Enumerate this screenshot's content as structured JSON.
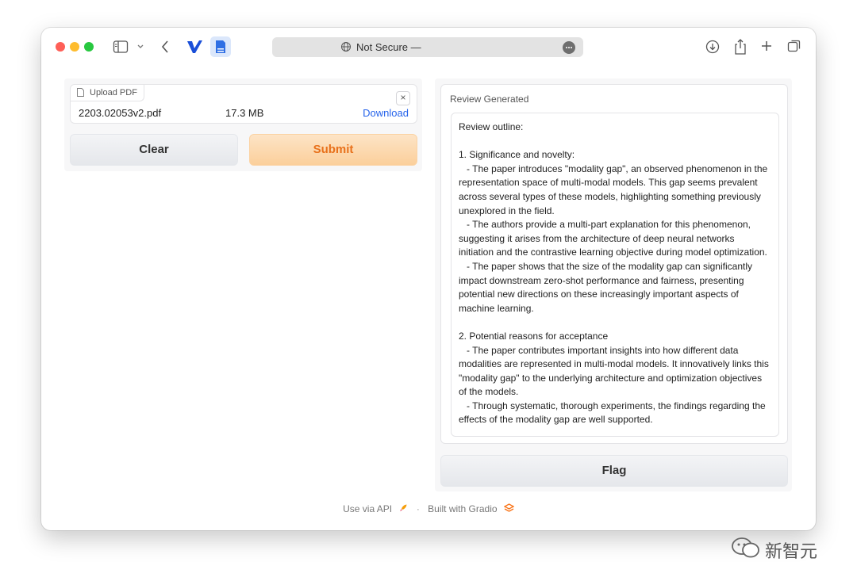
{
  "browser": {
    "address_text": "Not Secure —"
  },
  "upload": {
    "tab_label": "Upload PDF",
    "file_name": "2203.02053v2.pdf",
    "file_size": "17.3 MB",
    "download_label": "Download",
    "close_glyph": "×"
  },
  "buttons": {
    "clear_label": "Clear",
    "submit_label": "Submit",
    "flag_label": "Flag"
  },
  "review": {
    "label": "Review Generated",
    "text": "Review outline:\n\n1. Significance and novelty:\n   - The paper introduces \"modality gap\", an observed phenomenon in the representation space of multi-modal models. This gap seems prevalent across several types of these models, highlighting something previously unexplored in the field.\n   - The authors provide a multi-part explanation for this phenomenon, suggesting it arises from the architecture of deep neural networks initiation and the contrastive learning objective during model optimization.\n   - The paper shows that the size of the modality gap can significantly impact downstream zero-shot performance and fairness, presenting potential new directions on these increasingly important aspects of machine learning.\n\n2. Potential reasons for acceptance\n   - The paper contributes important insights into how different data modalities are represented in multi-modal models. It innovatively links this \"modality gap\" to the underlying architecture and optimization objectives of the models.\n   - Through systematic, thorough experiments, the findings regarding the effects of the modality gap are well supported."
  },
  "footer": {
    "api_label": "Use via API",
    "separator": "·",
    "built_label": "Built with Gradio"
  },
  "watermark": {
    "text": "新智元"
  },
  "colors": {
    "submit_bg": "#fbcf9b",
    "submit_text": "#e8711b",
    "link": "#2563eb",
    "traffic_red": "#fe5f57",
    "traffic_yellow": "#febc2e",
    "traffic_green": "#28c840"
  },
  "icons": {
    "toolbar": [
      "sidebar-icon",
      "chevron-down-icon",
      "back-icon",
      "vivaldi-tab-icon",
      "document-tab-icon",
      "globe-icon",
      "more-icon",
      "download-icon",
      "share-icon",
      "new-tab-icon",
      "tab-overview-icon"
    ],
    "upload": [
      "file-icon",
      "close-icon"
    ],
    "footer": [
      "rocket-icon",
      "gradio-logo-icon"
    ],
    "watermark": "wechat-icon"
  }
}
